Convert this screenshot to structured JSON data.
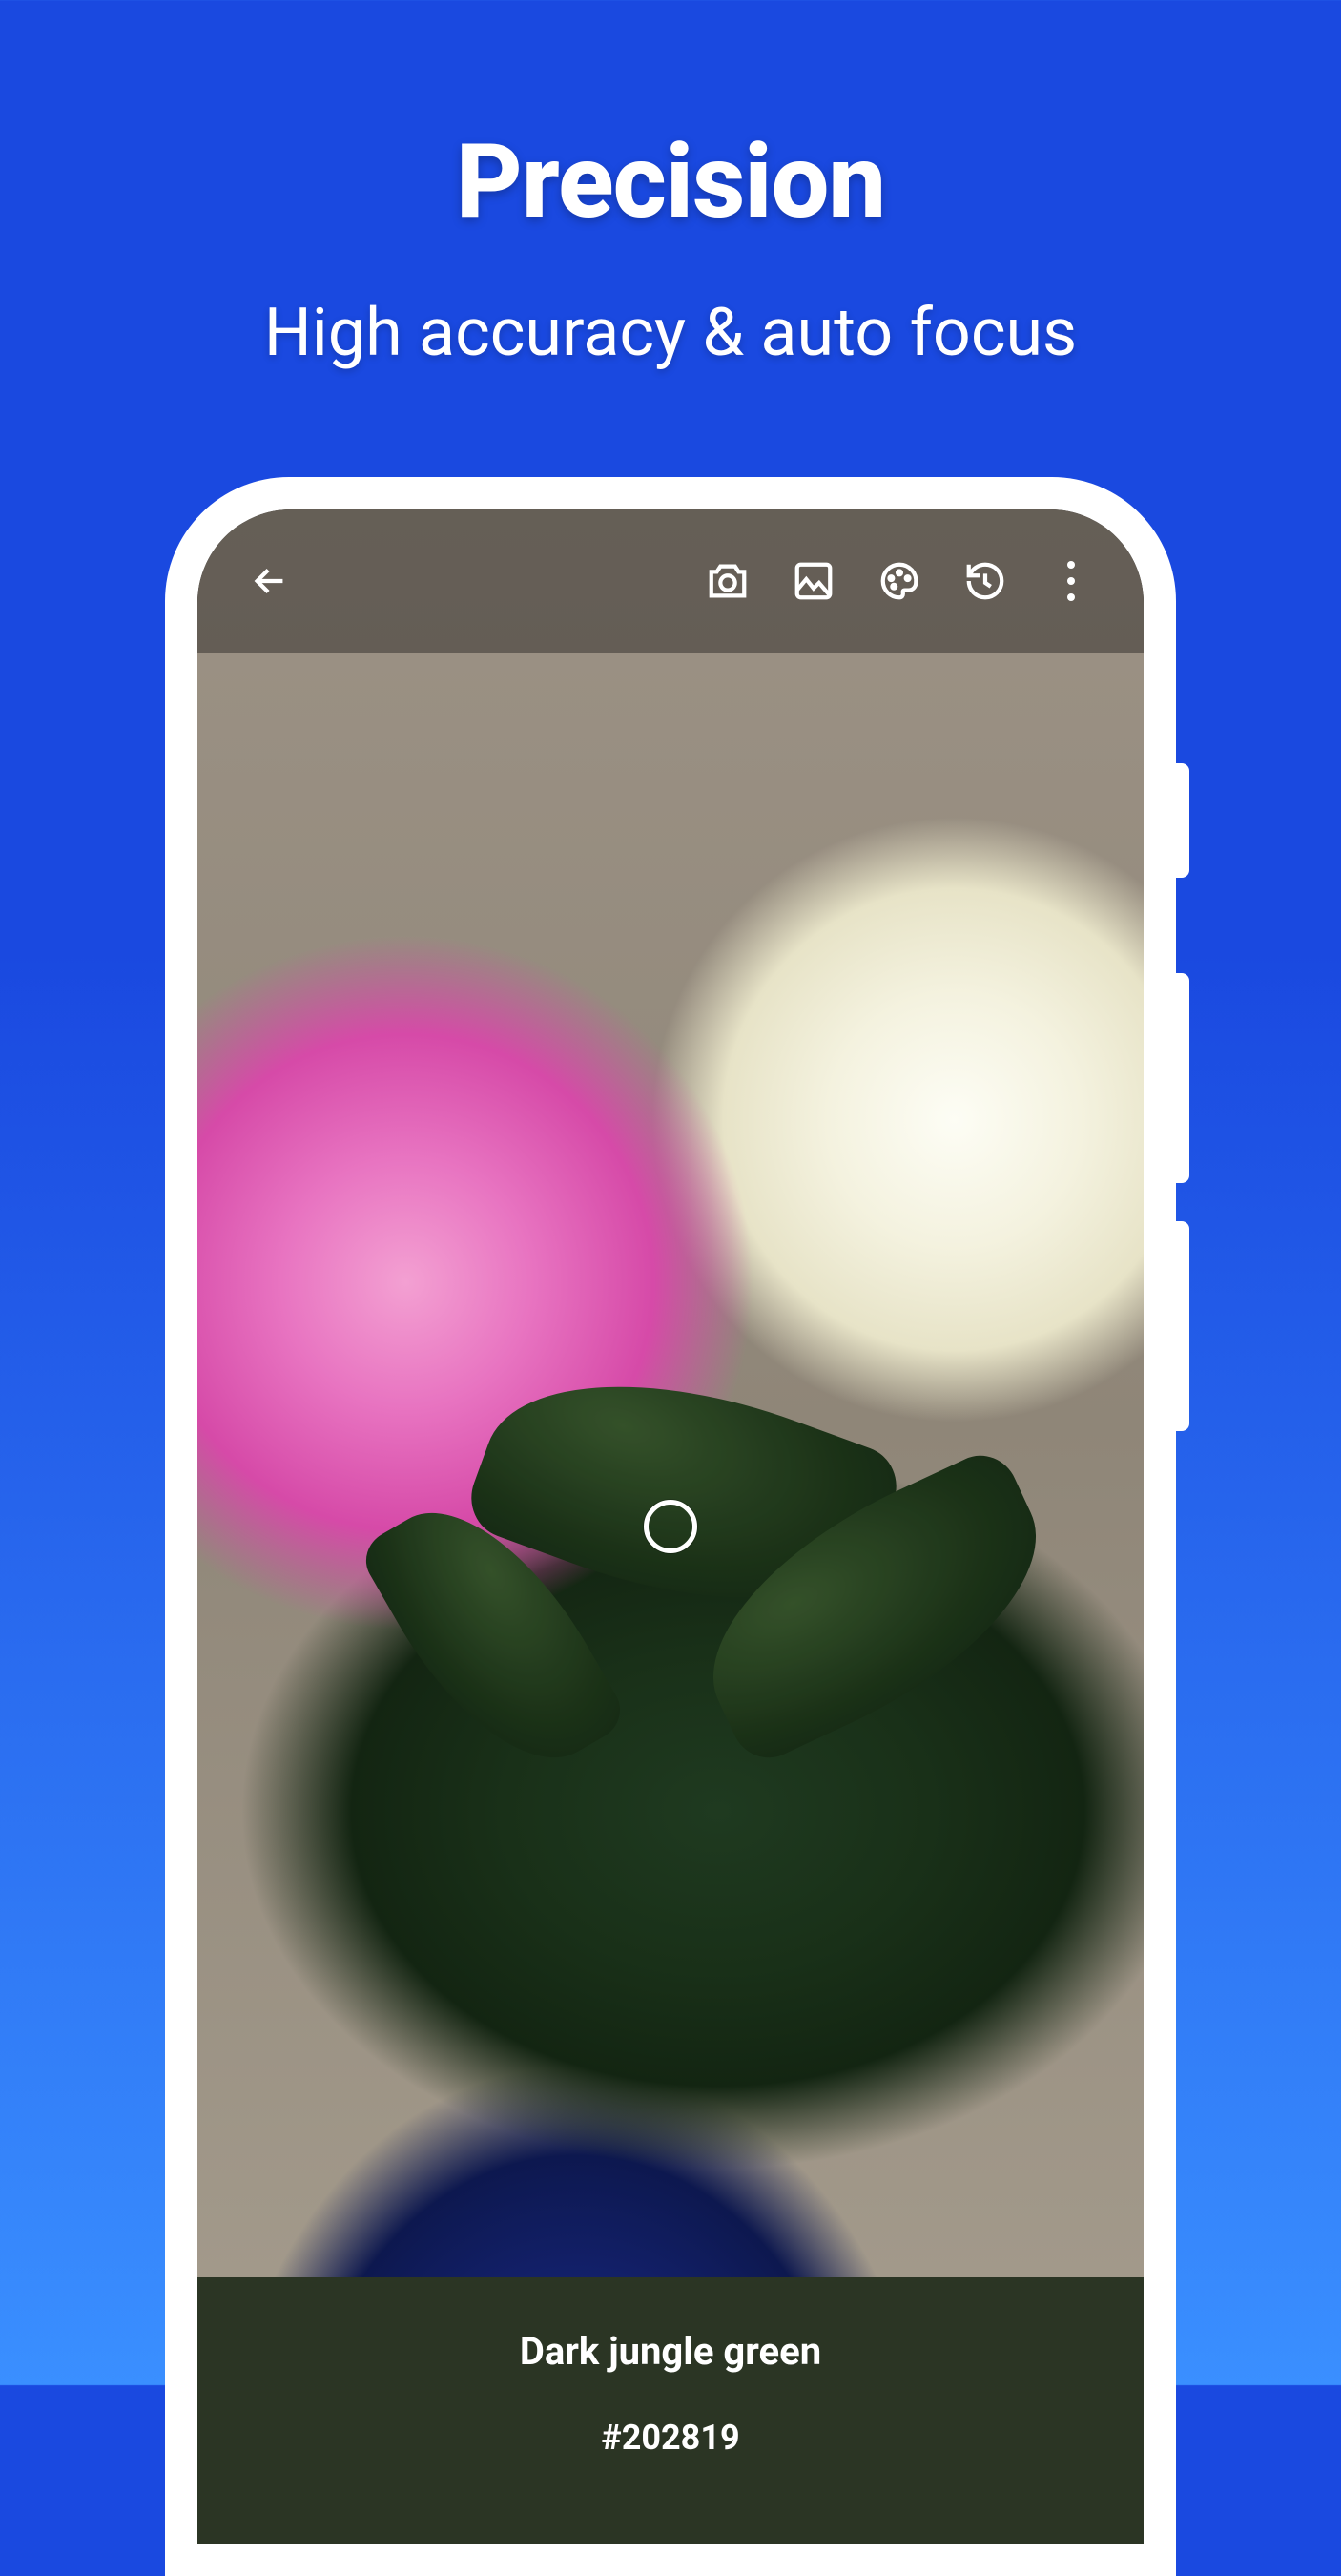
{
  "promo": {
    "title": "Precision",
    "subtitle": "High accuracy & auto focus"
  },
  "appbar": {
    "icons": {
      "back": "back-arrow",
      "camera": "camera",
      "gallery": "image",
      "palette": "palette",
      "history": "history",
      "more": "more-vert"
    }
  },
  "focus": {
    "label": "focus-indicator"
  },
  "readout": {
    "color_name": "Dark jungle green",
    "color_hex": "#202819",
    "swatch_color": "#2b3524"
  }
}
